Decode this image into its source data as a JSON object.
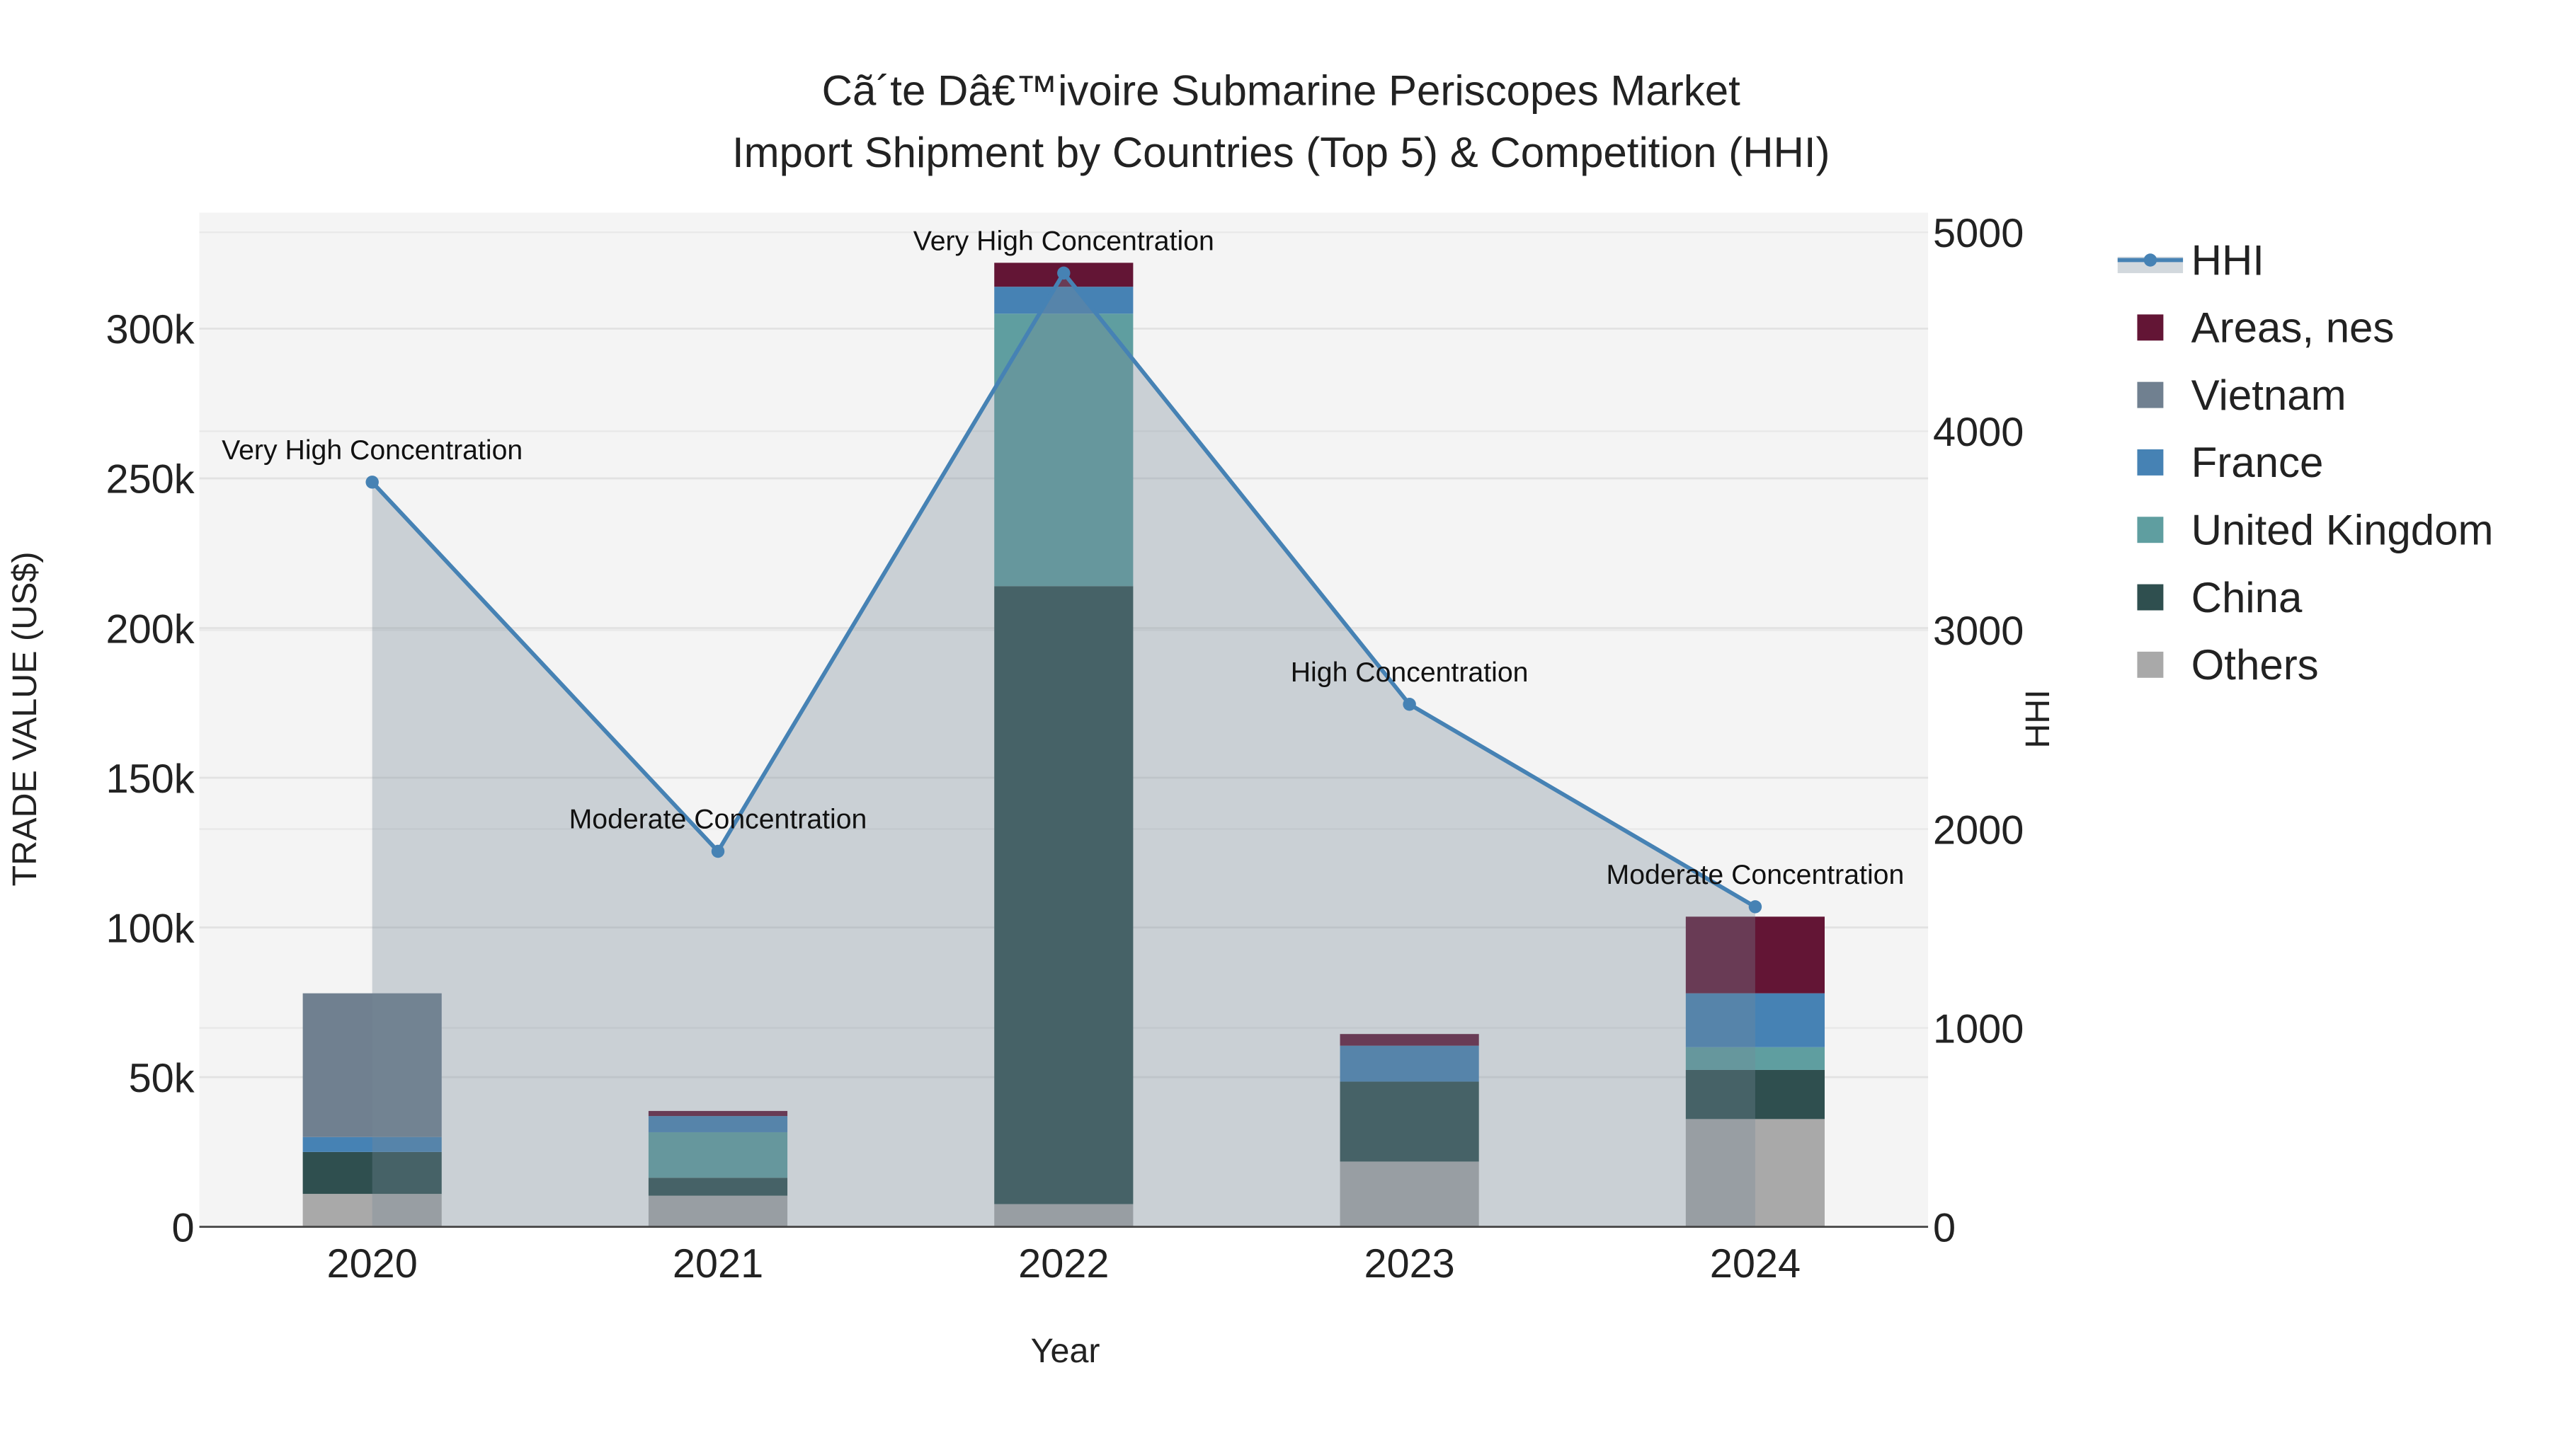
{
  "chart_data": {
    "type": "bar",
    "title": "Cã´te Dâ€™ivoire Submarine Periscopes Market",
    "subtitle": "Import Shipment by Countries (Top 5) & Competition (HHI)",
    "xlabel": "Year",
    "ylabel": "TRADE VALUE (US$)",
    "y2label": "HHI",
    "categories": [
      "2020",
      "2021",
      "2022",
      "2023",
      "2024"
    ],
    "ylim": [
      0,
      340000
    ],
    "y2lim": [
      0,
      5100
    ],
    "yticks": [
      0,
      50000,
      100000,
      150000,
      200000,
      250000,
      300000
    ],
    "ytick_labels": [
      "0",
      "50k",
      "100k",
      "150k",
      "200k",
      "250k",
      "300k"
    ],
    "y2ticks": [
      0,
      1000,
      2000,
      3000,
      4000,
      5000
    ],
    "y2tick_labels": [
      "0",
      "1000",
      "2000",
      "3000",
      "4000",
      "5000"
    ],
    "series": [
      {
        "name": "Others",
        "color": "#A9A9A9",
        "values": [
          11000,
          10400,
          7600,
          21800,
          36000
        ]
      },
      {
        "name": "China",
        "color": "#2F4F4F",
        "values": [
          14000,
          6000,
          206400,
          26700,
          16400
        ]
      },
      {
        "name": "United Kingdom",
        "color": "#5F9EA0",
        "values": [
          0,
          15200,
          91000,
          0,
          7600
        ]
      },
      {
        "name": "France",
        "color": "#4682B4",
        "values": [
          5000,
          5400,
          9000,
          12000,
          18000
        ]
      },
      {
        "name": "Vietnam",
        "color": "#708090",
        "values": [
          48000,
          0,
          0,
          0,
          0
        ]
      },
      {
        "name": "Areas, nes",
        "color": "#631535",
        "values": [
          0,
          1700,
          8000,
          3900,
          25600
        ]
      }
    ],
    "hhi": {
      "name": "HHI",
      "color": "#4682B4",
      "values": [
        3744,
        1888,
        4795,
        2627,
        1609
      ],
      "labels": [
        "Very High Concentration",
        "Moderate Concentration",
        "Very High Concentration",
        "High Concentration",
        "Moderate Concentration"
      ]
    },
    "legend_order": [
      "HHI",
      "Areas, nes",
      "Vietnam",
      "France",
      "United Kingdom",
      "China",
      "Others"
    ],
    "legend_placement": "top-right outside",
    "grid": true
  }
}
